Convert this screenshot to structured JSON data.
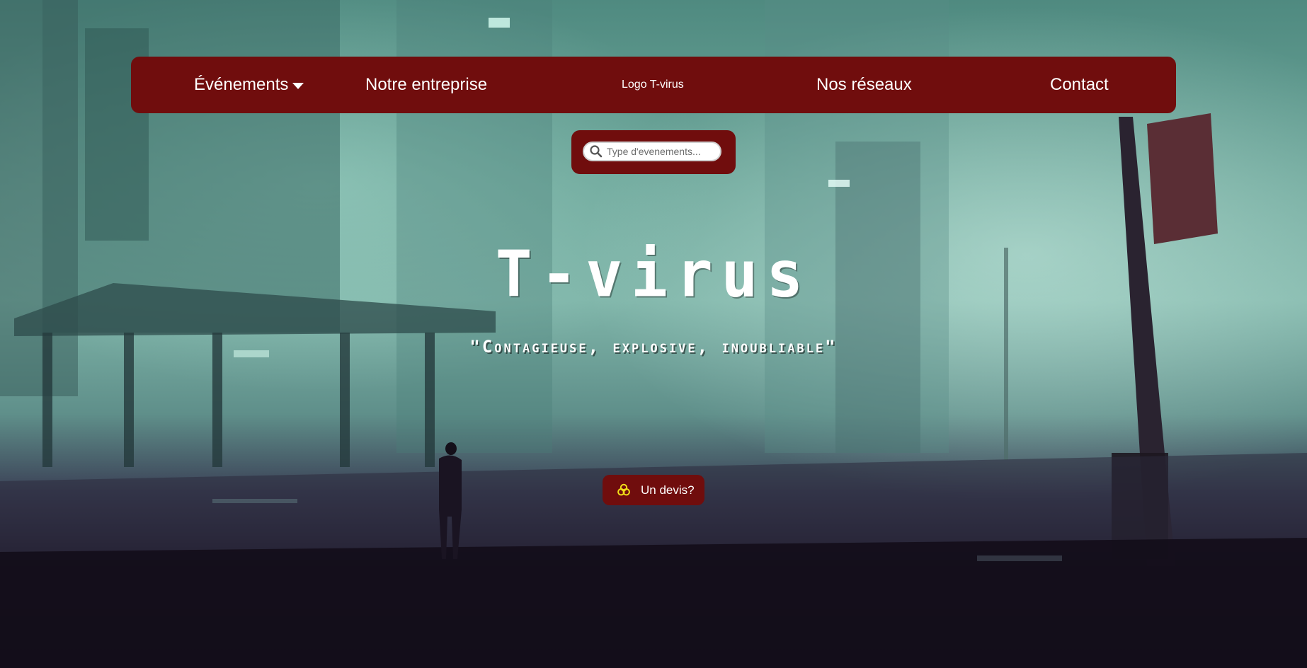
{
  "nav": {
    "events_label": "Événements",
    "company_label": "Notre entreprise",
    "logo_label": "Logo T-virus",
    "social_label": "Nos réseaux",
    "contact_label": "Contact"
  },
  "search": {
    "placeholder": "Type d'evenements..."
  },
  "hero": {
    "title": "T-virus",
    "tagline": "\"Contagieuse, explosive, inoubliable\""
  },
  "cta": {
    "label": "Un devis?"
  },
  "icons": {
    "events_dropdown": "caret-down-icon",
    "search": "search-icon",
    "cta": "biohazard-icon"
  },
  "colors": {
    "brand_red": "#700d0d",
    "text": "#ffffff",
    "biohazard": "#f2e019"
  }
}
